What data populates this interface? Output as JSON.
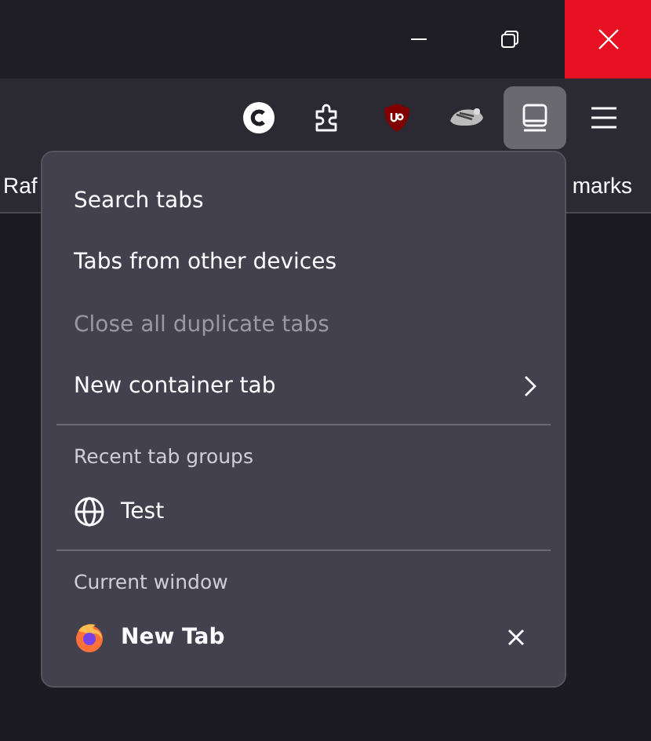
{
  "toolbar": {
    "buttons": [
      {
        "kind": "circle-c",
        "selected": false
      },
      {
        "kind": "puzzle",
        "selected": false
      },
      {
        "kind": "shield",
        "selected": false
      },
      {
        "kind": "badger",
        "selected": false
      },
      {
        "kind": "tablist",
        "selected": true
      },
      {
        "kind": "menu",
        "selected": false
      }
    ]
  },
  "bookmarks": {
    "left": "Raf",
    "right": "marks"
  },
  "menu": {
    "items": [
      {
        "kind": "action",
        "label": "Search tabs",
        "disabled": false,
        "submenu": false
      },
      {
        "kind": "action",
        "label": "Tabs from other devices",
        "disabled": false,
        "submenu": false
      },
      {
        "kind": "action",
        "label": "Close all duplicate tabs",
        "disabled": true,
        "submenu": false
      },
      {
        "kind": "action",
        "label": "New container tab",
        "disabled": false,
        "submenu": true
      },
      {
        "kind": "separator"
      },
      {
        "kind": "header",
        "label": "Recent tab groups"
      },
      {
        "kind": "group",
        "label": "Test"
      },
      {
        "kind": "separator"
      },
      {
        "kind": "header",
        "label": "Current window"
      },
      {
        "kind": "tab",
        "label": "New Tab",
        "closable": true
      }
    ]
  }
}
